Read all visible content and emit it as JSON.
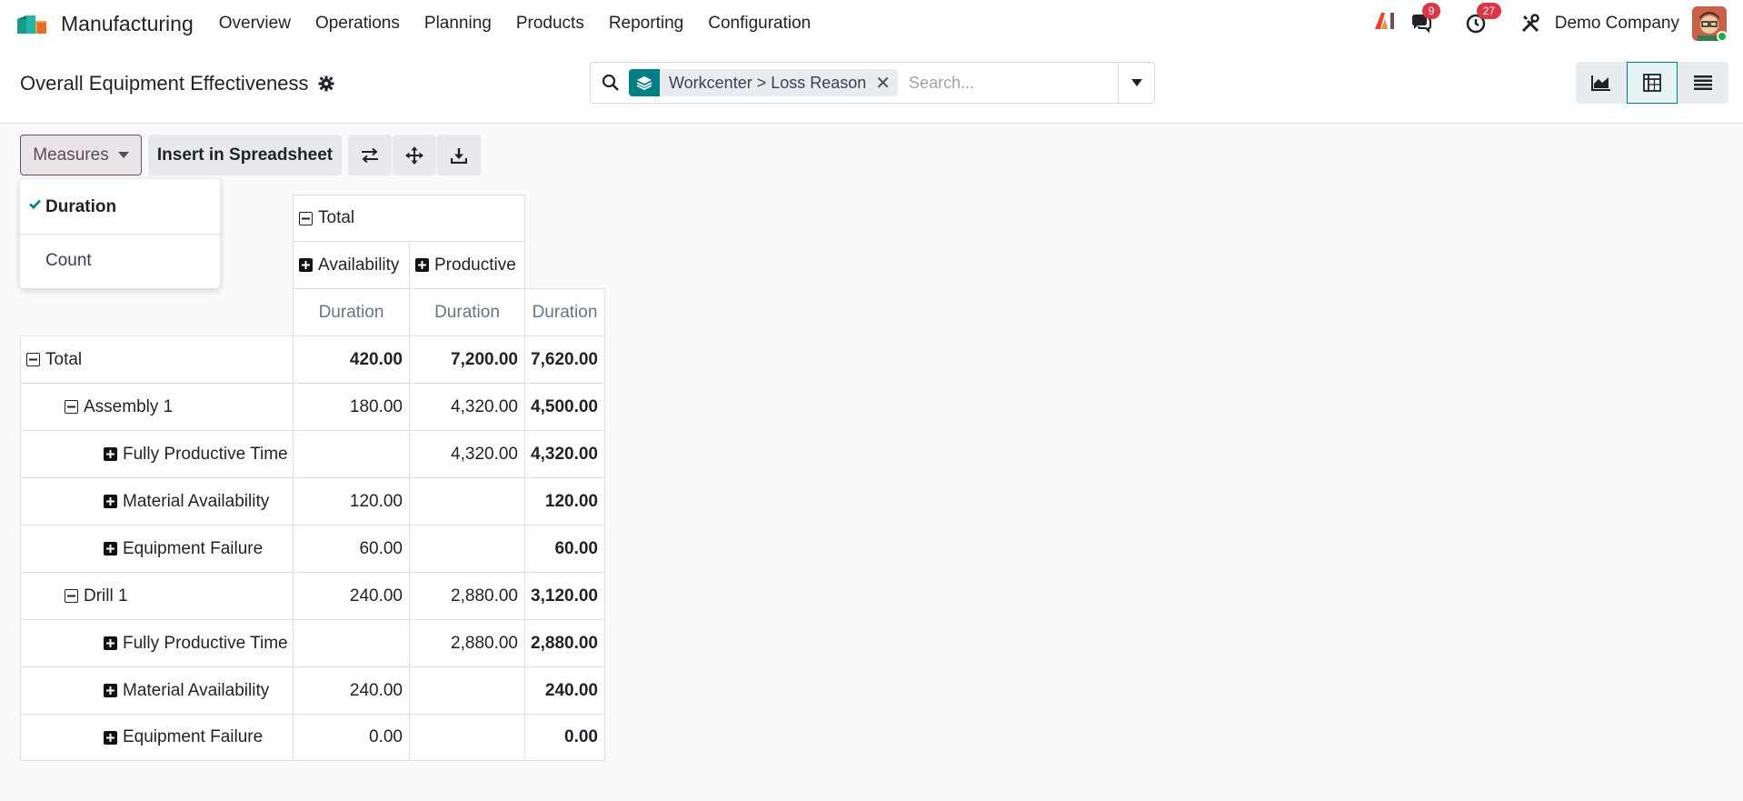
{
  "app": {
    "name": "Manufacturing",
    "menu": [
      "Overview",
      "Operations",
      "Planning",
      "Products",
      "Reporting",
      "Configuration"
    ]
  },
  "systray": {
    "ai_label": "AI",
    "messages_count": "9",
    "activities_count": "27",
    "company": "Demo Company",
    "accent": "#017e84",
    "badge_color": "#dc3545"
  },
  "control_panel": {
    "title": "Overall Equipment Effectiveness",
    "facet_text": "Workcenter > Loss Reason",
    "search_placeholder": "Search...",
    "views": [
      "graph",
      "pivot",
      "list"
    ],
    "active_view": "pivot"
  },
  "toolbar": {
    "measures_label": "Measures",
    "insert_label": "Insert in Spreadsheet"
  },
  "measures_dropdown": {
    "items": [
      {
        "label": "Duration",
        "selected": true
      },
      {
        "label": "Count",
        "selected": false
      }
    ]
  },
  "pivot": {
    "col_total": "Total",
    "col_groups": [
      "Availability",
      "Productive"
    ],
    "measure": "Duration",
    "rows": [
      {
        "label": "Total",
        "values": [
          "420.00",
          "7,200.00",
          "7,620.00"
        ]
      },
      {
        "label": "Assembly 1",
        "values": [
          "180.00",
          "4,320.00",
          "4,500.00"
        ]
      },
      {
        "label": "Fully Productive Time",
        "values": [
          "",
          "4,320.00",
          "4,320.00"
        ]
      },
      {
        "label": "Material Availability",
        "values": [
          "120.00",
          "",
          "120.00"
        ]
      },
      {
        "label": "Equipment Failure",
        "values": [
          "60.00",
          "",
          "60.00"
        ]
      },
      {
        "label": "Drill 1",
        "values": [
          "240.00",
          "2,880.00",
          "3,120.00"
        ]
      },
      {
        "label": "Fully Productive Time",
        "values": [
          "",
          "2,880.00",
          "2,880.00"
        ]
      },
      {
        "label": "Material Availability",
        "values": [
          "240.00",
          "",
          "240.00"
        ]
      },
      {
        "label": "Equipment Failure",
        "values": [
          "0.00",
          "",
          "0.00"
        ]
      }
    ]
  }
}
